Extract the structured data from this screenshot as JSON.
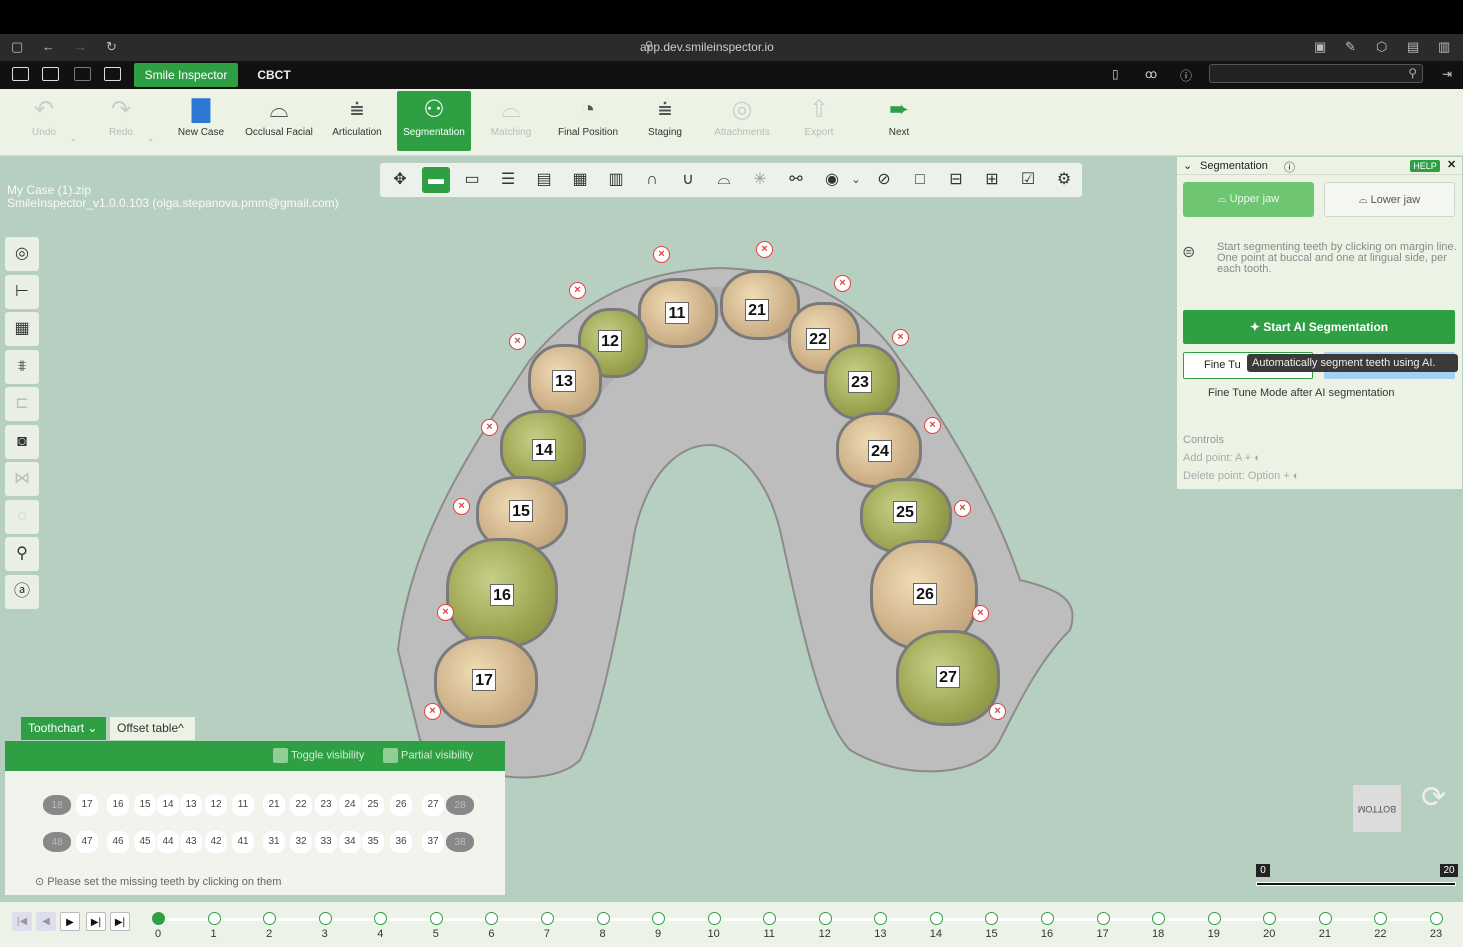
{
  "browser": {
    "url": "app.dev.smileinspector.io"
  },
  "app": {
    "tabs": [
      "Smile Inspector",
      "CBCT"
    ]
  },
  "toolbar": {
    "items": [
      {
        "label": "Undo",
        "icon": "undo-icon",
        "state": "disabled"
      },
      {
        "label": "Redo",
        "icon": "redo-icon",
        "state": "disabled"
      },
      {
        "label": "New Case",
        "icon": "new-case-icon",
        "state": "normal"
      },
      {
        "label": "Occlusal Facial",
        "icon": "occlusal-facial-icon",
        "state": "normal"
      },
      {
        "label": "Articulation",
        "icon": "articulation-icon",
        "state": "normal"
      },
      {
        "label": "Segmentation",
        "icon": "segmentation-icon",
        "state": "active"
      },
      {
        "label": "Matching",
        "icon": "matching-icon",
        "state": "disabled"
      },
      {
        "label": "Final Position",
        "icon": "final-position-icon",
        "state": "normal"
      },
      {
        "label": "Staging",
        "icon": "staging-icon",
        "state": "normal"
      },
      {
        "label": "Attachments",
        "icon": "attachments-icon",
        "state": "disabled"
      },
      {
        "label": "Export",
        "icon": "export-icon",
        "state": "disabled"
      },
      {
        "label": "Next",
        "icon": "next-icon",
        "state": "next"
      }
    ]
  },
  "case": {
    "file": "My Case (1).zip",
    "version": "SmileInspector_v1.0.0.103 (olga.stepanova.pmm@gmail.com)"
  },
  "teeth": [
    {
      "num": "11",
      "color": "tan"
    },
    {
      "num": "21",
      "color": "tan"
    },
    {
      "num": "12",
      "color": "olive"
    },
    {
      "num": "22",
      "color": "tan"
    },
    {
      "num": "13",
      "color": "tan"
    },
    {
      "num": "23",
      "color": "olive"
    },
    {
      "num": "14",
      "color": "olive"
    },
    {
      "num": "24",
      "color": "tan"
    },
    {
      "num": "15",
      "color": "tan"
    },
    {
      "num": "25",
      "color": "olive"
    },
    {
      "num": "16",
      "color": "olive"
    },
    {
      "num": "26",
      "color": "tan"
    },
    {
      "num": "17",
      "color": "tan"
    },
    {
      "num": "27",
      "color": "olive"
    }
  ],
  "segmentation": {
    "title": "Segmentation",
    "help": "HELP",
    "upper_jaw": "Upper jaw",
    "lower_jaw": "Lower jaw",
    "instructions": [
      "Start segmenting teeth by clicking on margin line.",
      "One point at buccal and one at lingual side, per each tooth."
    ],
    "start_ai": "Start AI Segmentation",
    "fine_tune": "Fine Tu",
    "tooltip": "Automatically segment teeth using AI.",
    "fine_tune_after": "Fine Tune Mode after AI segmentation",
    "controls_title": "Controls",
    "add_point": "Add point: A +",
    "delete_point": "Delete point: Option +"
  },
  "toothchart": {
    "tabs": [
      "Toothchart",
      "Offset table"
    ],
    "toggle_visibility": "Toggle visibility",
    "partial_visibility": "Partial visibility",
    "upper": [
      "18",
      "17",
      "16",
      "15",
      "14",
      "13",
      "12",
      "11",
      "21",
      "22",
      "23",
      "24",
      "25",
      "26",
      "27",
      "28"
    ],
    "lower": [
      "48",
      "47",
      "46",
      "45",
      "44",
      "43",
      "42",
      "41",
      "31",
      "32",
      "33",
      "34",
      "35",
      "36",
      "37",
      "38"
    ],
    "note": "Please set the missing teeth by clicking on them"
  },
  "view_cube": "BOTTOM",
  "scale": {
    "min": "0",
    "max": "20"
  },
  "timeline": {
    "stages": [
      "0",
      "1",
      "2",
      "3",
      "4",
      "5",
      "6",
      "7",
      "8",
      "9",
      "10",
      "11",
      "12",
      "13",
      "14",
      "15",
      "16",
      "17",
      "18",
      "19",
      "20",
      "21",
      "22",
      "23"
    ]
  },
  "colors": {
    "accent": "#2ea043",
    "tan": "#d8bf98",
    "olive": "#9ca450"
  }
}
